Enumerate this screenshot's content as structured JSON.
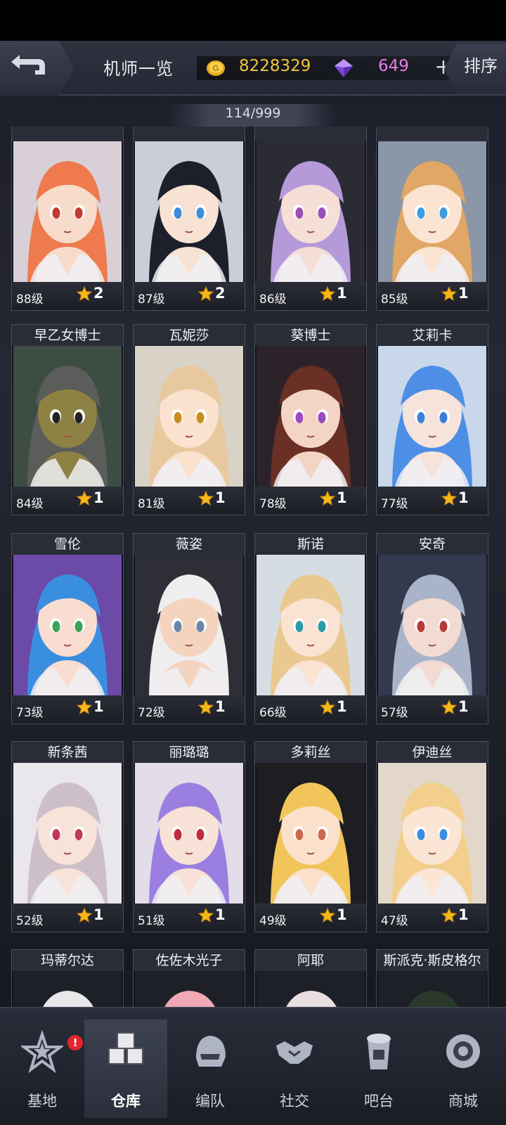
{
  "header": {
    "title": "机师一览",
    "gold": "8228329",
    "gems": "649",
    "plus": "+",
    "sort_label": "排序"
  },
  "count": "114/999",
  "cards": [
    {
      "name": "",
      "level": "88级",
      "stars": "2",
      "hair": "#ee7a4e",
      "skin": "#f8dccb",
      "eye": "#c23b2e",
      "bg": "#d8d0d6"
    },
    {
      "name": "",
      "level": "87级",
      "stars": "2",
      "hair": "#1d1f2b",
      "skin": "#f8e2d3",
      "eye": "#3c8fd8",
      "bg": "#c9ced8"
    },
    {
      "name": "",
      "level": "86级",
      "stars": "1",
      "hair": "#b59ad9",
      "skin": "#f5dfd6",
      "eye": "#9b4fb5",
      "bg": "#2a2b33"
    },
    {
      "name": "",
      "level": "85级",
      "stars": "1",
      "hair": "#e0a766",
      "skin": "#fbe4d1",
      "eye": "#3d9be2",
      "bg": "#8b96a6"
    },
    {
      "name": "早乙女博士",
      "level": "84级",
      "stars": "1",
      "hair": "#5b5d5a",
      "skin": "#8e8144",
      "eye": "#222",
      "bg": "#3e4d43"
    },
    {
      "name": "瓦妮莎",
      "level": "81级",
      "stars": "1",
      "hair": "#e8c89e",
      "skin": "#fbe2cf",
      "eye": "#c98d1c",
      "bg": "#d9d2c7"
    },
    {
      "name": "葵博士",
      "level": "78级",
      "stars": "1",
      "hair": "#6a2f25",
      "skin": "#f4d5c5",
      "eye": "#9a4bbf",
      "bg": "#2b2329"
    },
    {
      "name": "艾莉卡",
      "level": "77级",
      "stars": "1",
      "hair": "#4d8fe6",
      "skin": "#f6e3db",
      "eye": "#3b7fd9",
      "bg": "#c8d7ea"
    },
    {
      "name": "雪伦",
      "level": "73级",
      "stars": "1",
      "hair": "#3a8ee0",
      "skin": "#f8ddd0",
      "eye": "#3aa35a",
      "bg": "#6c4aa8"
    },
    {
      "name": "薇姿",
      "level": "72级",
      "stars": "1",
      "hair": "#eeeeee",
      "skin": "#f5d4bf",
      "eye": "#6a87a8",
      "bg": "#2e2e36"
    },
    {
      "name": "斯诺",
      "level": "66级",
      "stars": "1",
      "hair": "#e9c98f",
      "skin": "#fae3d3",
      "eye": "#2e9aa8",
      "bg": "#d6dde2"
    },
    {
      "name": "安奇",
      "level": "57级",
      "stars": "1",
      "hair": "#a9b3c9",
      "skin": "#f1dbd2",
      "eye": "#b53a3a",
      "bg": "#333a4d"
    },
    {
      "name": "新条茜",
      "level": "52级",
      "stars": "1",
      "hair": "#cdbfc8",
      "skin": "#f8e3da",
      "eye": "#c23a57",
      "bg": "#e9e6ec"
    },
    {
      "name": "丽璐璐",
      "level": "51级",
      "stars": "1",
      "hair": "#9b7fe0",
      "skin": "#f8e1d6",
      "eye": "#c02c3e",
      "bg": "#e2dde8"
    },
    {
      "name": "多莉丝",
      "level": "49级",
      "stars": "1",
      "hair": "#f1c55a",
      "skin": "#fbe1cc",
      "eye": "#d0694c",
      "bg": "#1d1d22"
    },
    {
      "name": "伊迪丝",
      "level": "47级",
      "stars": "1",
      "hair": "#f3cf8d",
      "skin": "#fbe5d4",
      "eye": "#3b8de0",
      "bg": "#e2d7c8"
    },
    {
      "name": "玛蒂尔达",
      "level": "",
      "stars": "",
      "hair": "#e8e8ea",
      "skin": "#f6e0d3",
      "eye": "#555",
      "bg": "#1e2027"
    },
    {
      "name": "佐佐木光子",
      "level": "",
      "stars": "",
      "hair": "#f0a9b5",
      "skin": "#f6e0d3",
      "eye": "#555",
      "bg": "#1e2027"
    },
    {
      "name": "阿耶",
      "level": "",
      "stars": "",
      "hair": "#eadfe0",
      "skin": "#f6e0d3",
      "eye": "#555",
      "bg": "#1e2027"
    },
    {
      "name": "斯派克·斯皮格尔",
      "level": "",
      "stars": "",
      "hair": "#2a3a2a",
      "skin": "#f6e0d3",
      "eye": "#555",
      "bg": "#1e2027"
    }
  ],
  "nav": [
    {
      "label": "基地",
      "icon": "base-star-icon"
    },
    {
      "label": "仓库",
      "icon": "warehouse-boxes-icon"
    },
    {
      "label": "编队",
      "icon": "formation-helmet-icon"
    },
    {
      "label": "社交",
      "icon": "social-handshake-icon"
    },
    {
      "label": "吧台",
      "icon": "bar-drink-icon"
    },
    {
      "label": "商城",
      "icon": "shop-robot-icon"
    }
  ],
  "nav_badge": "!",
  "colors": {
    "gold": "#f3c53c",
    "gem": "#e97ee8",
    "star": "#f5b819",
    "badge": "#e2262e"
  }
}
